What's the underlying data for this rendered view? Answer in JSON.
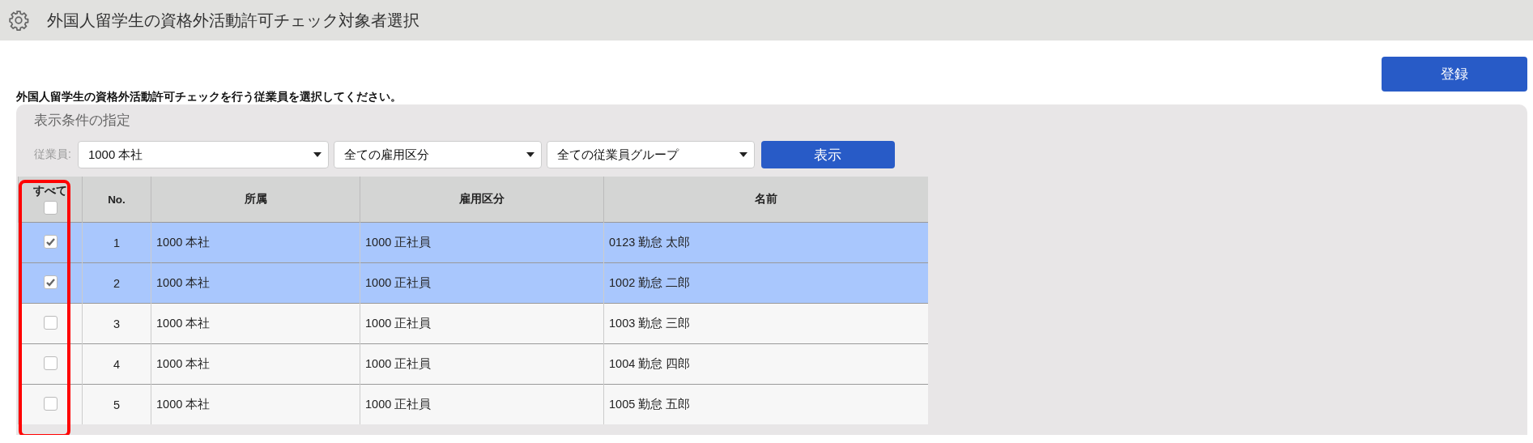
{
  "header": {
    "title": "外国人留学生の資格外活動許可チェック対象者選択"
  },
  "register_button": "登録",
  "instruction": "外国人留学生の資格外活動許可チェックを行う従業員を選択してください。",
  "filter_panel": {
    "title": "表示条件の指定",
    "employee_label": "従業員:",
    "dropdowns": [
      {
        "value": "1000 本社"
      },
      {
        "value": "全ての雇用区分"
      },
      {
        "value": "全ての従業員グループ"
      }
    ],
    "show_button": "表示"
  },
  "table": {
    "select_all": {
      "label": "すべて",
      "checked": false
    },
    "columns": [
      "No.",
      "所属",
      "雇用区分",
      "名前"
    ],
    "rows": [
      {
        "no": "1",
        "department": "1000 本社",
        "employment_type": "1000 正社員",
        "name": "0123 勤怠 太郎",
        "checked": true,
        "selected": true
      },
      {
        "no": "2",
        "department": "1000 本社",
        "employment_type": "1000 正社員",
        "name": "1002 勤怠 二郎",
        "checked": true,
        "selected": true
      },
      {
        "no": "3",
        "department": "1000 本社",
        "employment_type": "1000 正社員",
        "name": "1003 勤怠 三郎",
        "checked": false,
        "selected": false
      },
      {
        "no": "4",
        "department": "1000 本社",
        "employment_type": "1000 正社員",
        "name": "1004 勤怠 四郎",
        "checked": false,
        "selected": false
      },
      {
        "no": "5",
        "department": "1000 本社",
        "employment_type": "1000 正社員",
        "name": "1005 勤怠 五郎",
        "checked": false,
        "selected": false
      }
    ]
  }
}
